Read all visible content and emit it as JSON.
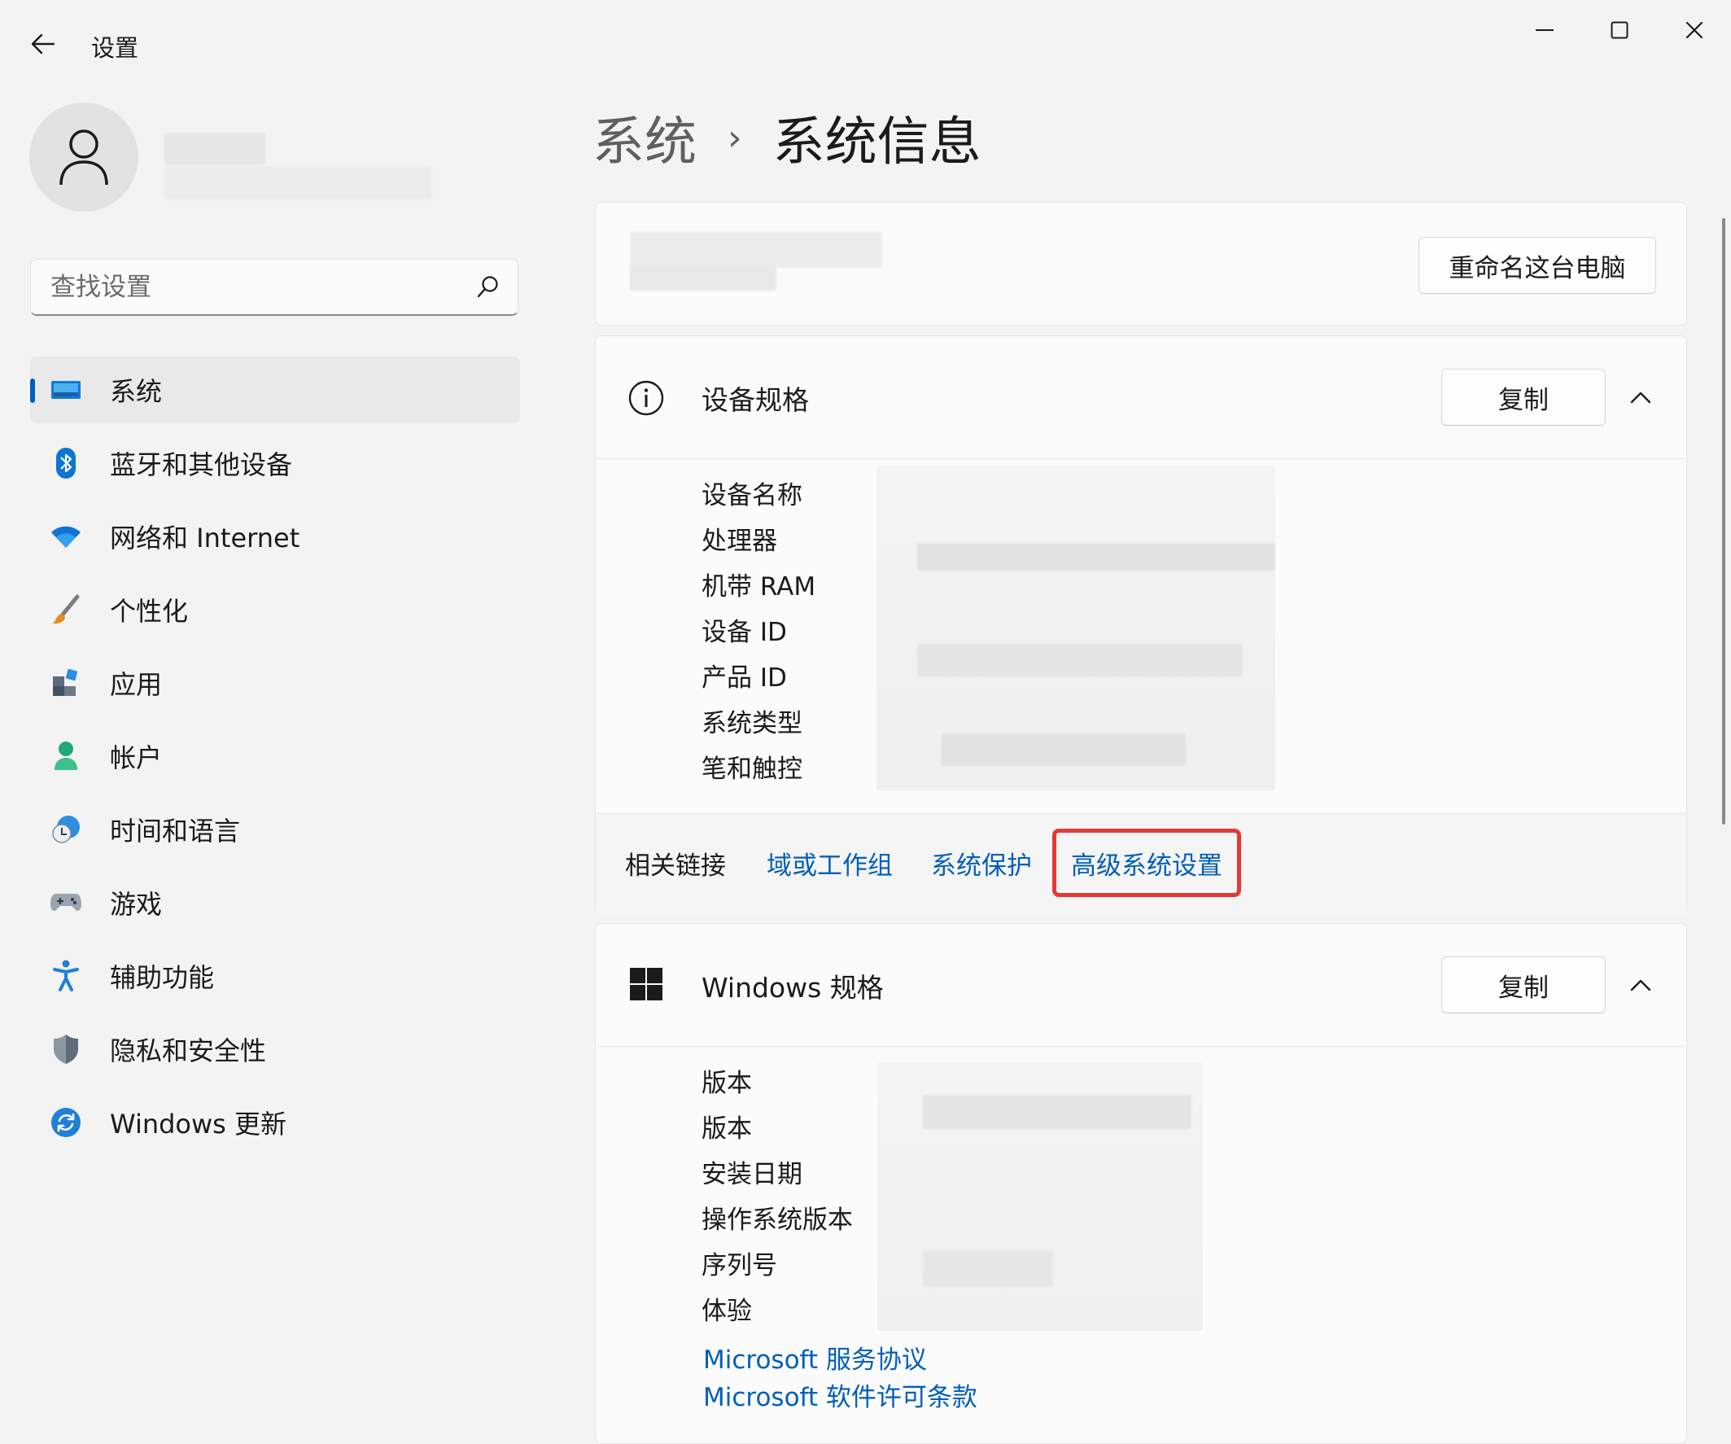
{
  "window": {
    "title": "设置",
    "back_icon": "arrow-left-icon",
    "controls": [
      "minimize-icon",
      "maximize-icon",
      "close-icon"
    ]
  },
  "user": {
    "avatar_icon": "person-icon"
  },
  "search": {
    "placeholder": "查找设置",
    "value": "",
    "icon": "search-icon"
  },
  "sidebar": {
    "items": [
      {
        "label": "系统",
        "icon": "monitor-icon",
        "active": true
      },
      {
        "label": "蓝牙和其他设备",
        "icon": "bluetooth-icon"
      },
      {
        "label": "网络和 Internet",
        "icon": "wifi-icon"
      },
      {
        "label": "个性化",
        "icon": "brush-icon"
      },
      {
        "label": "应用",
        "icon": "apps-icon"
      },
      {
        "label": "帐户",
        "icon": "account-icon"
      },
      {
        "label": "时间和语言",
        "icon": "clock-globe-icon"
      },
      {
        "label": "游戏",
        "icon": "gamepad-icon"
      },
      {
        "label": "辅助功能",
        "icon": "accessibility-icon"
      },
      {
        "label": "隐私和安全性",
        "icon": "shield-icon"
      },
      {
        "label": "Windows 更新",
        "icon": "refresh-icon"
      }
    ]
  },
  "breadcrumb": {
    "parent": "系统",
    "separator": "›",
    "current": "系统信息"
  },
  "pc_card": {
    "rename_button": "重命名这台电脑"
  },
  "device_specs": {
    "title": "设备规格",
    "icon": "info-icon",
    "copy_button": "复制",
    "labels": [
      "设备名称",
      "处理器",
      "机带 RAM",
      "设备 ID",
      "产品 ID",
      "系统类型",
      "笔和触控"
    ]
  },
  "related_links": {
    "label": "相关链接",
    "links": [
      "域或工作组",
      "系统保护",
      "高级系统设置"
    ],
    "highlight_color": "#e53935"
  },
  "windows_specs": {
    "title": "Windows 规格",
    "icon": "windows-logo-icon",
    "copy_button": "复制",
    "labels": [
      "版本",
      "版本",
      "安装日期",
      "操作系统版本",
      "序列号",
      "体验"
    ],
    "links": [
      "Microsoft 服务协议",
      "Microsoft 软件许可条款"
    ]
  },
  "colors": {
    "accent": "#005fb8",
    "background": "#f3f3f3",
    "card": "#fbfbfb"
  }
}
